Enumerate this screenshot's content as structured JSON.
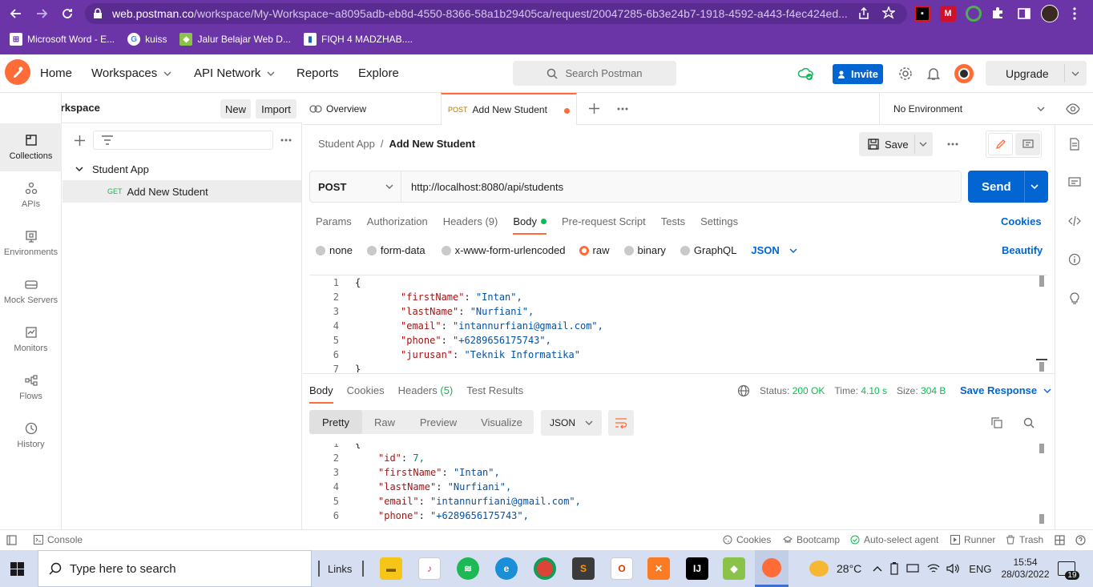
{
  "browser": {
    "url_host": "web.postman.co",
    "url_path": "/workspace/My-Workspace~a8095adb-eb8d-4550-8366-58a1b29405ca/request/20047285-6b3e24b7-1918-4592-a443-f4ec424ed...",
    "bookmarks": [
      "Microsoft Word - E...",
      "kuiss",
      "Jalur Belajar Web D...",
      "FIQH 4 MADZHAB...."
    ]
  },
  "header": {
    "nav": [
      "Home",
      "Workspaces",
      "API Network",
      "Reports",
      "Explore"
    ],
    "search_placeholder": "Search Postman",
    "invite_label": "Invite",
    "upgrade_label": "Upgrade"
  },
  "workspace": {
    "name": "My Workspace",
    "new_label": "New",
    "import_label": "Import"
  },
  "left_rail": [
    {
      "label": "Collections",
      "icon": "collections-icon"
    },
    {
      "label": "APIs",
      "icon": "apis-icon"
    },
    {
      "label": "Environments",
      "icon": "environments-icon"
    },
    {
      "label": "Mock Servers",
      "icon": "mock-servers-icon"
    },
    {
      "label": "Monitors",
      "icon": "monitors-icon"
    },
    {
      "label": "Flows",
      "icon": "flows-icon"
    },
    {
      "label": "History",
      "icon": "history-icon"
    }
  ],
  "tree": {
    "collection": "Student App",
    "request_method": "GET",
    "request_name": "Add New Student"
  },
  "tabs": {
    "overview_label": "Overview",
    "active_method": "POST",
    "active_name": "Add New Student",
    "environment": "No Environment"
  },
  "request": {
    "breadcrumb_parent": "Student App",
    "breadcrumb_sep": "/",
    "breadcrumb_current": "Add New Student",
    "save_label": "Save",
    "method": "POST",
    "url": "http://localhost:8080/api/students",
    "send_label": "Send",
    "tabs": [
      "Params",
      "Authorization",
      "Headers",
      "Body",
      "Pre-request Script",
      "Tests",
      "Settings"
    ],
    "headers_count": "(9)",
    "cookies_label": "Cookies",
    "body_types": [
      "none",
      "form-data",
      "x-www-form-urlencoded",
      "raw",
      "binary",
      "GraphQL"
    ],
    "format": "JSON",
    "beautify_label": "Beautify",
    "line_numbers": [
      "1",
      "2",
      "3",
      "4",
      "5",
      "6",
      "7"
    ],
    "body_lines": [
      {
        "key": "",
        "value": "",
        "raw": "{"
      },
      {
        "key": "\"firstName\"",
        "value": "\"Intan\","
      },
      {
        "key": "\"lastName\"",
        "value": "\"Nurfiani\","
      },
      {
        "key": "\"email\"",
        "value": "\"intannurfiani@gmail.com\","
      },
      {
        "key": "\"phone\"",
        "value": "\"+6289656175743\","
      },
      {
        "key": "\"jurusan\"",
        "value": "\"Teknik Informatika\""
      },
      {
        "key": "",
        "value": "",
        "raw": "}"
      }
    ]
  },
  "response": {
    "tabs": [
      "Body",
      "Cookies",
      "Headers",
      "Test Results"
    ],
    "headers_count": "(5)",
    "status_label": "Status:",
    "status_value": "200 OK",
    "time_label": "Time:",
    "time_value": "4.10 s",
    "size_label": "Size:",
    "size_value": "304 B",
    "save_response_label": "Save Response",
    "views": [
      "Pretty",
      "Raw",
      "Preview",
      "Visualize"
    ],
    "format": "JSON",
    "line_numbers": [
      "1",
      "2",
      "3",
      "4",
      "5",
      "6"
    ],
    "body_lines": [
      {
        "key": "",
        "value": "",
        "raw": "{"
      },
      {
        "key": "\"id\"",
        "value": "7,",
        "num": true
      },
      {
        "key": "\"firstName\"",
        "value": "\"Intan\","
      },
      {
        "key": "\"lastName\"",
        "value": "\"Nurfiani\","
      },
      {
        "key": "\"email\"",
        "value": "\"intannurfiani@gmail.com\","
      },
      {
        "key": "\"phone\"",
        "value": "\"+6289656175743\","
      }
    ]
  },
  "footer": {
    "console_label": "Console",
    "cookies_label": "Cookies",
    "bootcamp_label": "Bootcamp",
    "agent_label": "Auto-select agent",
    "runner_label": "Runner",
    "trash_label": "Trash"
  },
  "taskbar": {
    "search_placeholder": "Type here to search",
    "links_label": "Links",
    "temperature": "28°C",
    "language": "ENG",
    "time": "15:54",
    "date": "28/03/2022",
    "notification_count": "19"
  },
  "colors": {
    "brand": "#ff6c37",
    "primary": "#0265d2",
    "browser_frame": "#6b35a8",
    "success": "#0cbb52"
  }
}
